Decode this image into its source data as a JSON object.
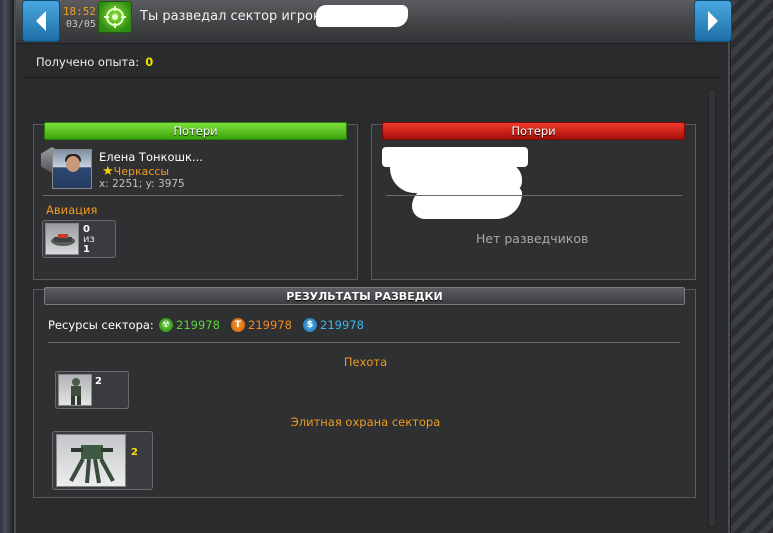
{
  "header": {
    "time": "18:52",
    "date": "03/05",
    "title": "Ты разведал сектор игрока",
    "nav_prev_icon": "chevron-left-icon",
    "nav_next_icon": "chevron-right-icon",
    "message_icon": "scout-target-icon"
  },
  "experience": {
    "label": "Получено опыта:",
    "value": "0"
  },
  "attacker_panel": {
    "tab_label": "Потери",
    "player": {
      "name": "Елена Тонкошк...",
      "city": "Черкассы",
      "coords": "x: 2251; y: 3975"
    },
    "section_label": "Авиация",
    "unit": {
      "lost": "0",
      "of_label": "из",
      "total": "1"
    }
  },
  "defender_panel": {
    "tab_label": "Потери",
    "empty_text": "Нет разведчиков"
  },
  "results_panel": {
    "tab_label": "РЕЗУЛЬТАТЫ РАЗВЕДКИ",
    "resources_label": "Ресурсы сектора:",
    "resources": [
      {
        "icon": "radiation-icon",
        "symbol": "☢",
        "value": "219978",
        "color": "#5ad83a"
      },
      {
        "icon": "titanium-icon",
        "symbol": "T",
        "value": "219978",
        "color": "#f58a20"
      },
      {
        "icon": "credits-icon",
        "symbol": "$",
        "value": "219978",
        "color": "#3ab8e8"
      }
    ],
    "infantry_label": "Пехота",
    "infantry_count": "2",
    "elite_label": "Элитная охрана сектора",
    "elite_count": "2"
  },
  "colors": {
    "accent_orange": "#f09a20",
    "exp_yellow": "#f5e000",
    "tab_green": "#3aa40c",
    "tab_red": "#a80e0a",
    "nav_blue": "#1e6ea8"
  }
}
